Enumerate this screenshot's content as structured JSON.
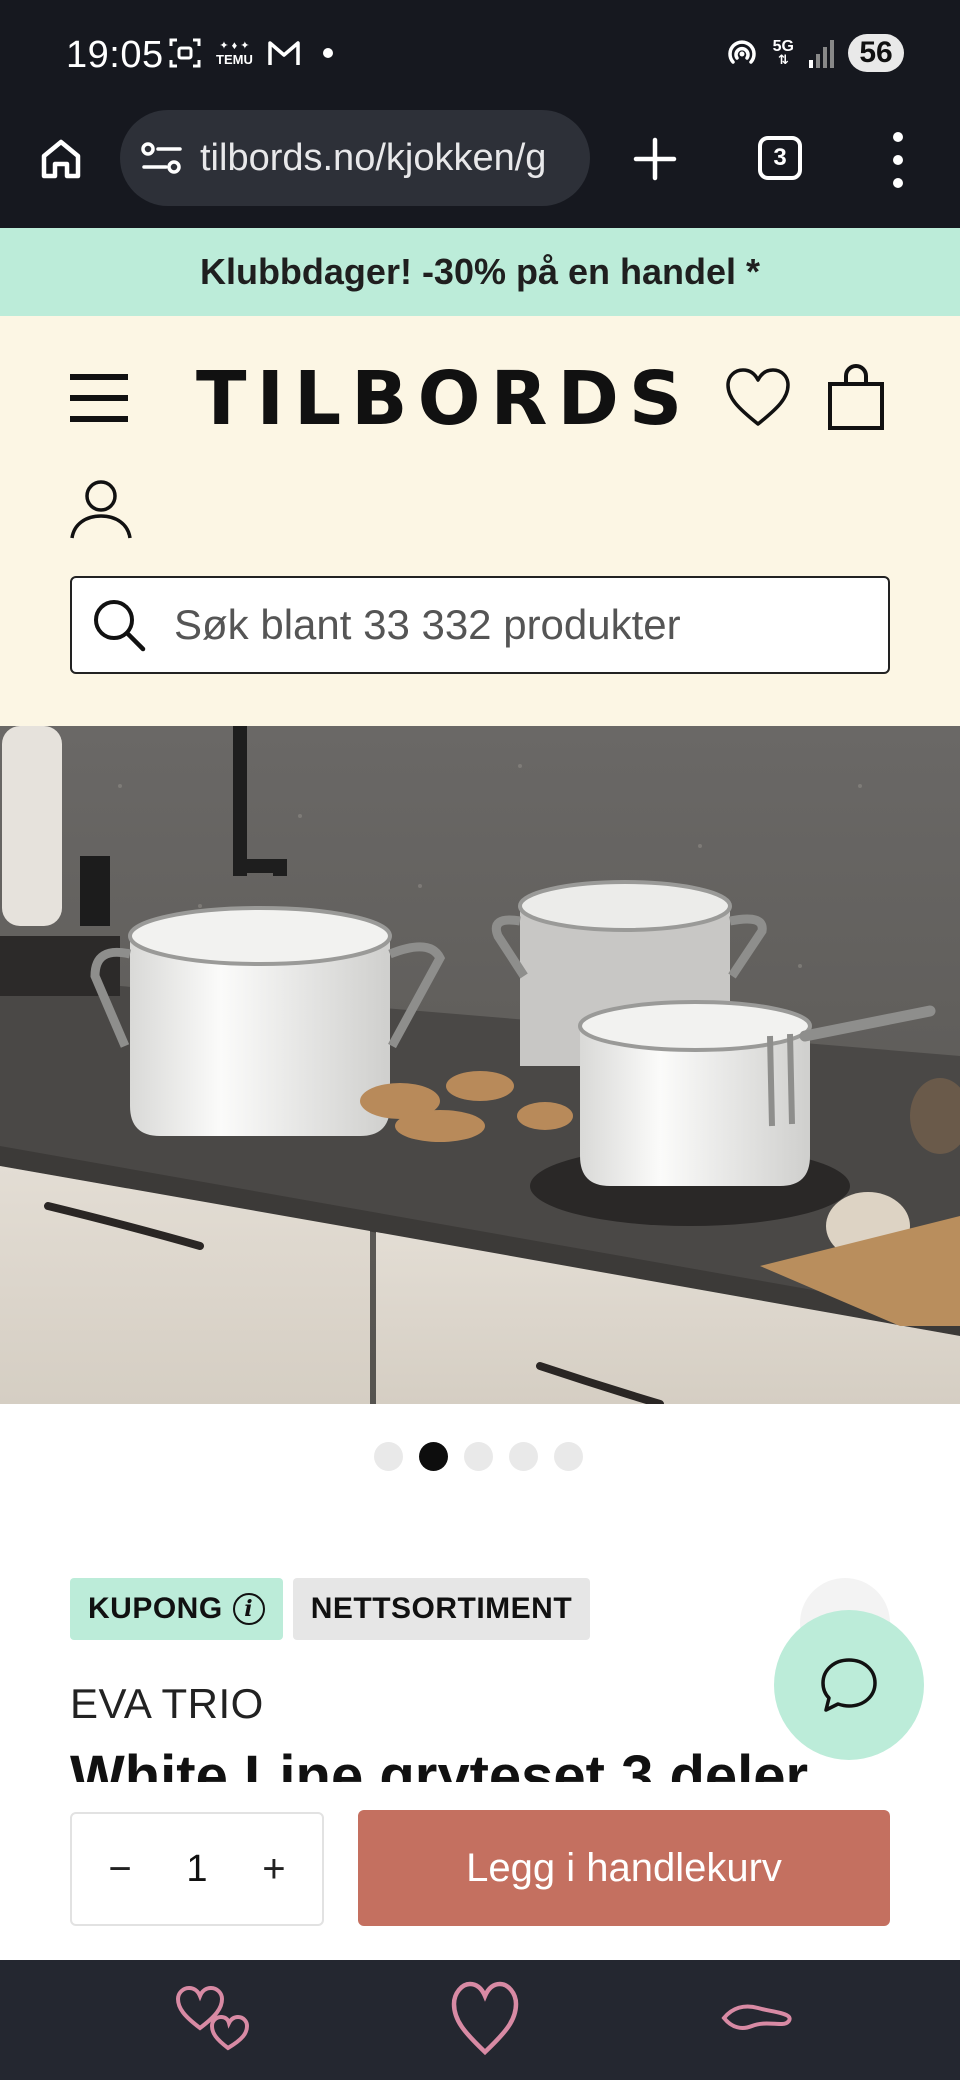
{
  "status_bar": {
    "time": "19:05",
    "temu_label": "TEMU",
    "signal_label": "5G",
    "battery": "56"
  },
  "browser": {
    "url": "tilbords.no/kjokken/g",
    "tab_count": "3"
  },
  "promo_banner": {
    "text": "Klubbdager! -30% på en handel *"
  },
  "header": {
    "logo": "TILBORDS",
    "search_placeholder": "Søk blant 33 332 produkter"
  },
  "carousel": {
    "total_dots": 5,
    "active_index": 1
  },
  "product": {
    "tags": [
      "KUPONG",
      "NETTSORTIMENT"
    ],
    "brand": "EVA TRIO",
    "title": "White Line gryteset 3 deler"
  },
  "cart": {
    "quantity": "1",
    "minus_label": "−",
    "plus_label": "+",
    "add_to_cart_label": "Legg i handlekurv"
  },
  "colors": {
    "promo_bg": "#bcecd9",
    "header_bg": "#fcf6e4",
    "cta_bg": "#c47060",
    "nav_icon": "#d88aa4"
  }
}
